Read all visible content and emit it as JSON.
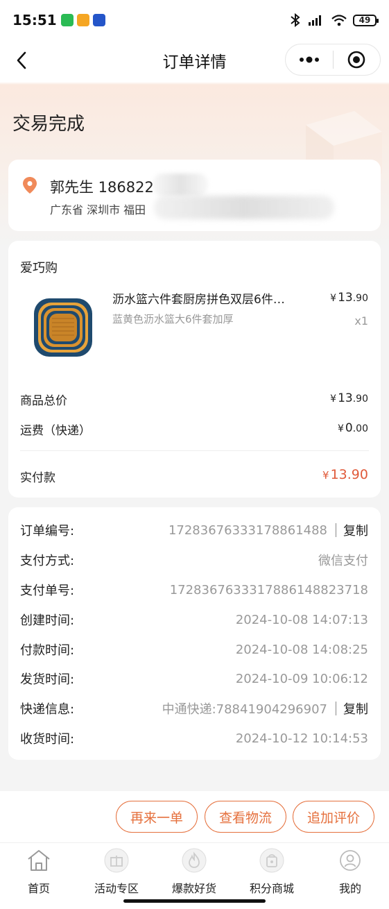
{
  "status_bar": {
    "time": "15:51",
    "battery": "49"
  },
  "nav": {
    "title": "订单详情"
  },
  "order_status": "交易完成",
  "address": {
    "name_phone": "郭先生 186822",
    "detail": "广东省 深圳市 福田"
  },
  "order": {
    "shop": "爱巧购",
    "product_title": "沥水篮六件套厨房拼色双层6件…",
    "product_sku": "蓝黄色沥水篮大6件套加厚",
    "unit_price": {
      "symbol": "¥",
      "int": "13",
      "dec": ".90"
    },
    "quantity": "x1",
    "subtotal_label": "商品总价",
    "subtotal": {
      "symbol": "¥",
      "int": "13",
      "dec": ".90"
    },
    "shipping_label": "运费（快递）",
    "shipping": {
      "symbol": "¥",
      "int": "0",
      "dec": ".00"
    },
    "paid_label": "实付款",
    "paid": {
      "symbol": "¥",
      "amount": "13.90"
    }
  },
  "info": [
    {
      "key": "订单编号:",
      "value": "17283676333178861488",
      "copy": "复制"
    },
    {
      "key": "支付方式:",
      "value": "微信支付"
    },
    {
      "key": "支付单号:",
      "value": "1728367633317886148823718"
    },
    {
      "key": "创建时间:",
      "value": "2024-10-08 14:07:13"
    },
    {
      "key": "付款时间:",
      "value": "2024-10-08 14:08:25"
    },
    {
      "key": "发货时间:",
      "value": "2024-10-09 10:06:12"
    },
    {
      "key": "快递信息:",
      "value": "中通快递:78841904296907",
      "copy": "复制"
    },
    {
      "key": "收货时间:",
      "value": "2024-10-12 10:14:53"
    }
  ],
  "actions": {
    "reorder": "再来一单",
    "logistics": "查看物流",
    "review": "追加评价"
  },
  "tabs": [
    {
      "label": "首页",
      "icon": "home-icon"
    },
    {
      "label": "活动专区",
      "icon": "gift-icon"
    },
    {
      "label": "爆款好货",
      "icon": "flame-icon"
    },
    {
      "label": "积分商城",
      "icon": "shopping-bag-icon"
    },
    {
      "label": "我的",
      "icon": "user-icon"
    }
  ],
  "colors": {
    "accent": "#e5703d",
    "price_red": "#e05a3a",
    "page_bg": "#f4f4f4"
  }
}
